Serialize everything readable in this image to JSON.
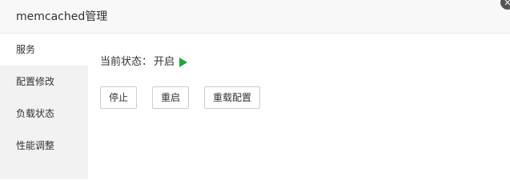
{
  "dialog": {
    "title": "memcached管理",
    "close_glyph": "✕"
  },
  "sidebar": {
    "items": [
      {
        "label": "服务",
        "active": true
      },
      {
        "label": "配置修改",
        "active": false
      },
      {
        "label": "负载状态",
        "active": false
      },
      {
        "label": "性能调整",
        "active": false
      }
    ]
  },
  "service": {
    "status_label": "当前状态：",
    "status_value": "开启",
    "status_icon": "play-icon",
    "status_color": "#20a53a",
    "buttons": {
      "stop": "停止",
      "restart": "重启",
      "reload": "重载配置"
    }
  }
}
